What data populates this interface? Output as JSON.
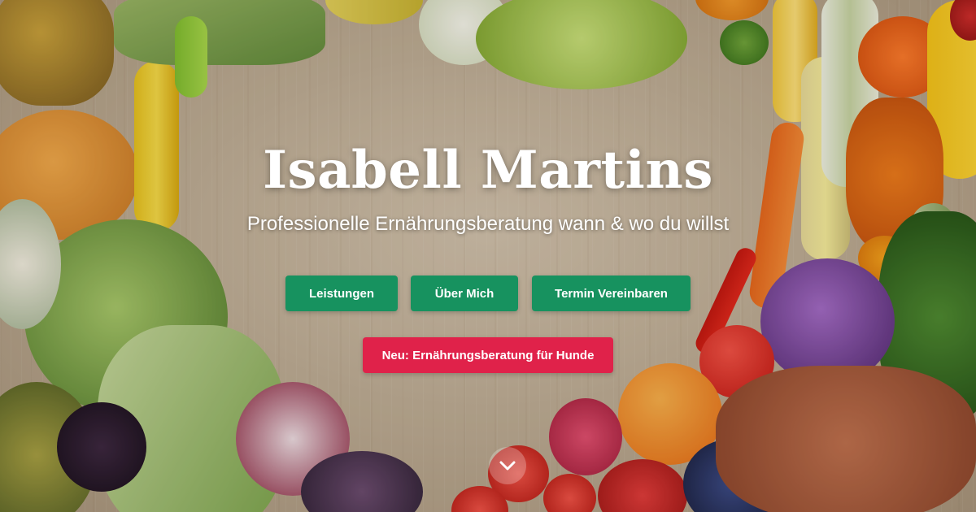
{
  "hero": {
    "title": "Isabell Martins",
    "subtitle": "Professionelle Ernährungsberatung wann & wo du willst"
  },
  "nav_buttons": {
    "services": "Leistungen",
    "about": "Über Mich",
    "appointment": "Termin Vereinbaren"
  },
  "promo_button": "Neu: Ernährungsberatung für Hunde",
  "scroll_icon": "chevron-down-icon",
  "colors": {
    "primary_green": "#17925f",
    "accent_red": "#e0224a",
    "text": "#ffffff"
  }
}
